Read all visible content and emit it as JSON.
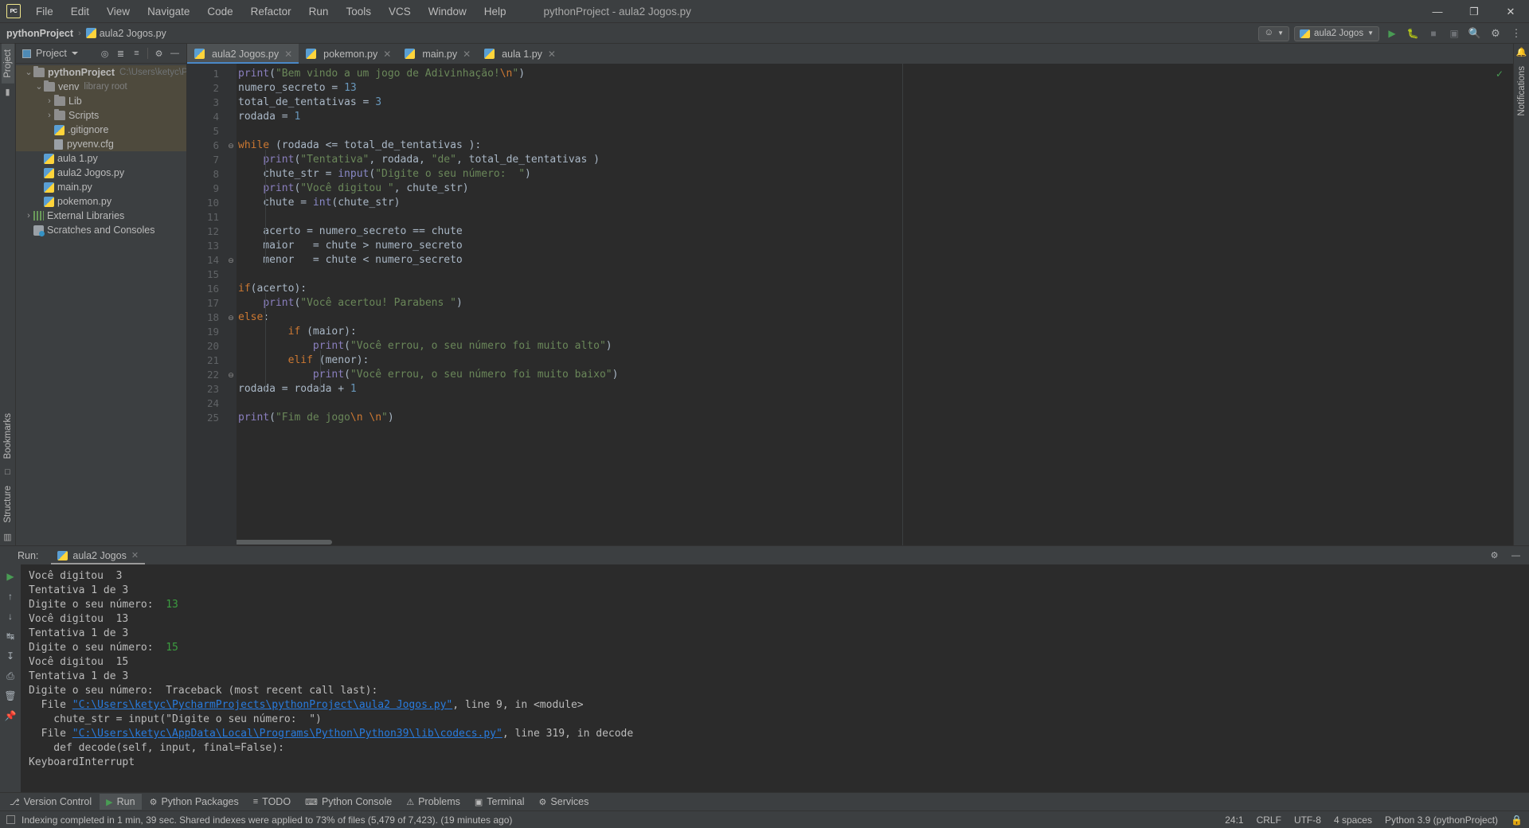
{
  "titlebar": {
    "logo": "PC",
    "menus": [
      "File",
      "Edit",
      "View",
      "Navigate",
      "Code",
      "Refactor",
      "Run",
      "Tools",
      "VCS",
      "Window",
      "Help"
    ],
    "project_title": "pythonProject - aula2 Jogos.py",
    "minimize": "—",
    "maximize": "❐",
    "close": "✕"
  },
  "navbar": {
    "crumb_project": "pythonProject",
    "crumb_sep": "›",
    "crumb_file": "aula2 Jogos.py",
    "run_config": "aula2 Jogos",
    "run_icon": "▶",
    "debug_icon": "🐞",
    "stop_icon": "■",
    "coverage_icon": "▣",
    "search_icon": "🔍",
    "settings_icon": "⚙",
    "account_icon": "👤",
    "more_icon": "⋮"
  },
  "left_strip": {
    "project_tab": "Project",
    "bookmarks_tab": "Bookmarks",
    "structure_tab": "Structure"
  },
  "right_strip": {
    "notifications_tab": "Notifications"
  },
  "project_panel": {
    "title": "Project",
    "tools": [
      "target-icon",
      "collapse-all-icon",
      "expand-all-icon",
      "gear-icon",
      "hide-icon"
    ],
    "tree": [
      {
        "depth": 0,
        "label": "pythonProject",
        "hint": "C:\\Users\\ketyc\\PycharmPr",
        "icon": "folder-icon",
        "arrow": "⌄",
        "bold": true,
        "highlight": true
      },
      {
        "depth": 1,
        "label": "venv",
        "hint": "library root",
        "icon": "folder-icon",
        "arrow": "⌄",
        "bold": false,
        "highlight": true
      },
      {
        "depth": 2,
        "label": "Lib",
        "hint": "",
        "icon": "folder-icon",
        "arrow": "›",
        "bold": false,
        "highlight": true
      },
      {
        "depth": 2,
        "label": "Scripts",
        "hint": "",
        "icon": "folder-icon",
        "arrow": "›",
        "bold": false,
        "highlight": true
      },
      {
        "depth": 2,
        "label": ".gitignore",
        "hint": "",
        "icon": "gitignore-icon",
        "arrow": "",
        "bold": false,
        "highlight": true
      },
      {
        "depth": 2,
        "label": "pyvenv.cfg",
        "hint": "",
        "icon": "config-file-icon",
        "arrow": "",
        "bold": false,
        "highlight": true
      },
      {
        "depth": 1,
        "label": "aula 1.py",
        "hint": "",
        "icon": "python-file-icon",
        "arrow": "",
        "bold": false,
        "highlight": false
      },
      {
        "depth": 1,
        "label": "aula2 Jogos.py",
        "hint": "",
        "icon": "python-file-icon",
        "arrow": "",
        "bold": false,
        "highlight": false
      },
      {
        "depth": 1,
        "label": "main.py",
        "hint": "",
        "icon": "python-file-icon",
        "arrow": "",
        "bold": false,
        "highlight": false
      },
      {
        "depth": 1,
        "label": "pokemon.py",
        "hint": "",
        "icon": "python-file-icon",
        "arrow": "",
        "bold": false,
        "highlight": false
      },
      {
        "depth": 0,
        "label": "External Libraries",
        "hint": "",
        "icon": "libraries-icon",
        "arrow": "›",
        "bold": false,
        "highlight": false
      },
      {
        "depth": 0,
        "label": "Scratches and Consoles",
        "hint": "",
        "icon": "scratches-icon",
        "arrow": "",
        "bold": false,
        "highlight": false
      }
    ]
  },
  "editor": {
    "tabs": [
      {
        "label": "aula2 Jogos.py",
        "active": true
      },
      {
        "label": "pokemon.py",
        "active": false
      },
      {
        "label": "main.py",
        "active": false
      },
      {
        "label": "aula 1.py",
        "active": false
      }
    ],
    "close_glyph": "✕",
    "line_numbers": [
      1,
      2,
      3,
      4,
      5,
      6,
      7,
      8,
      9,
      10,
      11,
      12,
      13,
      14,
      15,
      16,
      17,
      18,
      19,
      20,
      21,
      22,
      23,
      24,
      25
    ],
    "code_lines": [
      {
        "n": 1,
        "tokens": [
          {
            "t": "print",
            "c": "f"
          },
          {
            "t": "(",
            "c": "p"
          },
          {
            "t": "\"Bem vindo a um jogo de Adivinhação!",
            "c": "s"
          },
          {
            "t": "\\n",
            "c": "e"
          },
          {
            "t": "\"",
            "c": "s"
          },
          {
            "t": ")",
            "c": "p"
          }
        ]
      },
      {
        "n": 2,
        "tokens": [
          {
            "t": "numero_secreto = ",
            "c": "p"
          },
          {
            "t": "13",
            "c": "n"
          }
        ]
      },
      {
        "n": 3,
        "tokens": [
          {
            "t": "total_de_tentativas = ",
            "c": "p"
          },
          {
            "t": "3",
            "c": "n"
          }
        ]
      },
      {
        "n": 4,
        "tokens": [
          {
            "t": "rodada = ",
            "c": "p"
          },
          {
            "t": "1",
            "c": "n"
          }
        ]
      },
      {
        "n": 5,
        "tokens": []
      },
      {
        "n": 6,
        "tokens": [
          {
            "t": "while",
            "c": "k"
          },
          {
            "t": " (rodada <= total_de_tentativas ):",
            "c": "p"
          }
        ]
      },
      {
        "n": 7,
        "tokens": [
          {
            "t": "    ",
            "c": "p"
          },
          {
            "t": "print",
            "c": "f"
          },
          {
            "t": "(",
            "c": "p"
          },
          {
            "t": "\"Tentativa\"",
            "c": "s"
          },
          {
            "t": ", rodada, ",
            "c": "p"
          },
          {
            "t": "\"de\"",
            "c": "s"
          },
          {
            "t": ", total_de_tentativas )",
            "c": "p"
          }
        ]
      },
      {
        "n": 8,
        "tokens": [
          {
            "t": "    chute_str = ",
            "c": "p"
          },
          {
            "t": "input",
            "c": "b"
          },
          {
            "t": "(",
            "c": "p"
          },
          {
            "t": "\"Digite o seu número:  \"",
            "c": "s"
          },
          {
            "t": ")",
            "c": "p"
          }
        ]
      },
      {
        "n": 9,
        "tokens": [
          {
            "t": "    ",
            "c": "p"
          },
          {
            "t": "print",
            "c": "f"
          },
          {
            "t": "(",
            "c": "p"
          },
          {
            "t": "\"Você digitou \"",
            "c": "s"
          },
          {
            "t": ", chute_str)",
            "c": "p"
          }
        ]
      },
      {
        "n": 10,
        "tokens": [
          {
            "t": "    chute = ",
            "c": "p"
          },
          {
            "t": "int",
            "c": "b"
          },
          {
            "t": "(chute_str)",
            "c": "p"
          }
        ]
      },
      {
        "n": 11,
        "tokens": []
      },
      {
        "n": 12,
        "tokens": [
          {
            "t": "    acerto = numero_secreto == chute",
            "c": "p"
          }
        ]
      },
      {
        "n": 13,
        "tokens": [
          {
            "t": "    maior   = chute > numero_secreto",
            "c": "p"
          }
        ]
      },
      {
        "n": 14,
        "tokens": [
          {
            "t": "    menor   = chute < numero_secreto",
            "c": "p"
          }
        ]
      },
      {
        "n": 15,
        "tokens": []
      },
      {
        "n": 16,
        "tokens": [
          {
            "t": "if",
            "c": "k"
          },
          {
            "t": "(acerto):",
            "c": "p"
          }
        ]
      },
      {
        "n": 17,
        "tokens": [
          {
            "t": "    ",
            "c": "p"
          },
          {
            "t": "print",
            "c": "f"
          },
          {
            "t": "(",
            "c": "p"
          },
          {
            "t": "\"Você acertou! Parabens \"",
            "c": "s"
          },
          {
            "t": ")",
            "c": "p"
          }
        ]
      },
      {
        "n": 18,
        "tokens": [
          {
            "t": "else",
            "c": "k"
          },
          {
            "t": ":",
            "c": "p"
          }
        ]
      },
      {
        "n": 19,
        "tokens": [
          {
            "t": "        ",
            "c": "p"
          },
          {
            "t": "if",
            "c": "k"
          },
          {
            "t": " (maior):",
            "c": "p"
          }
        ]
      },
      {
        "n": 20,
        "tokens": [
          {
            "t": "            ",
            "c": "p"
          },
          {
            "t": "print",
            "c": "f"
          },
          {
            "t": "(",
            "c": "p"
          },
          {
            "t": "\"Você errou, o seu número foi muito alto\"",
            "c": "s"
          },
          {
            "t": ")",
            "c": "p"
          }
        ]
      },
      {
        "n": 21,
        "tokens": [
          {
            "t": "        ",
            "c": "p"
          },
          {
            "t": "elif",
            "c": "k"
          },
          {
            "t": " (menor):",
            "c": "p"
          }
        ]
      },
      {
        "n": 22,
        "tokens": [
          {
            "t": "            ",
            "c": "p"
          },
          {
            "t": "print",
            "c": "f"
          },
          {
            "t": "(",
            "c": "p"
          },
          {
            "t": "\"Você errou, o seu número foi muito baixo\"",
            "c": "s"
          },
          {
            "t": ")",
            "c": "p"
          }
        ]
      },
      {
        "n": 23,
        "tokens": [
          {
            "t": "rodada = rodada + ",
            "c": "p"
          },
          {
            "t": "1",
            "c": "n"
          }
        ]
      },
      {
        "n": 24,
        "tokens": []
      },
      {
        "n": 25,
        "tokens": [
          {
            "t": "print",
            "c": "f"
          },
          {
            "t": "(",
            "c": "p"
          },
          {
            "t": "\"Fim de jogo",
            "c": "s"
          },
          {
            "t": "\\n",
            "c": "e"
          },
          {
            "t": " ",
            "c": "s"
          },
          {
            "t": "\\n",
            "c": "e"
          },
          {
            "t": "\"",
            "c": "s"
          },
          {
            "t": ")",
            "c": "p"
          }
        ]
      }
    ],
    "fold_marks": {
      "6": "⊖",
      "14": "⊖",
      "18": "⊖",
      "22": "⊖"
    },
    "inspection_status": "✓"
  },
  "run_panel": {
    "label": "Run:",
    "tab_name": "aula2 Jogos",
    "close_glyph": "✕",
    "settings_icon": "⚙",
    "hide_icon": "—",
    "toolbar_icons": [
      "rerun-icon",
      "up-icon",
      "down-icon",
      "soft-wrap-icon",
      "scroll-end-icon",
      "print-icon",
      "trash-icon",
      "pin-icon"
    ],
    "console_lines": [
      {
        "segments": [
          {
            "t": "Você digitou  3",
            "c": "c-out"
          }
        ]
      },
      {
        "segments": [
          {
            "t": "Tentativa 1 de 3",
            "c": "c-out"
          }
        ]
      },
      {
        "segments": [
          {
            "t": "Digite o seu número:  ",
            "c": "c-out"
          },
          {
            "t": "13",
            "c": "c-in"
          }
        ]
      },
      {
        "segments": [
          {
            "t": "Você digitou  13",
            "c": "c-out"
          }
        ]
      },
      {
        "segments": [
          {
            "t": "Tentativa 1 de 3",
            "c": "c-out"
          }
        ]
      },
      {
        "segments": [
          {
            "t": "Digite o seu número:  ",
            "c": "c-out"
          },
          {
            "t": "15",
            "c": "c-in"
          }
        ]
      },
      {
        "segments": [
          {
            "t": "Você digitou  15",
            "c": "c-out"
          }
        ]
      },
      {
        "segments": [
          {
            "t": "Tentativa 1 de 3",
            "c": "c-out"
          }
        ]
      },
      {
        "segments": [
          {
            "t": "Digite o seu número:  ",
            "c": "c-out"
          },
          {
            "t": "Traceback (most recent call last):",
            "c": "c-err"
          }
        ]
      },
      {
        "segments": [
          {
            "t": "  File ",
            "c": "c-err"
          },
          {
            "t": "\"C:\\Users\\ketyc\\PycharmProjects\\pythonProject\\aula2 Jogos.py\"",
            "c": "c-link"
          },
          {
            "t": ", line 9, in <module>",
            "c": "c-err"
          }
        ]
      },
      {
        "segments": [
          {
            "t": "    chute_str = input(\"Digite o seu número:  \")",
            "c": "c-err"
          }
        ]
      },
      {
        "segments": [
          {
            "t": "  File ",
            "c": "c-err"
          },
          {
            "t": "\"C:\\Users\\ketyc\\AppData\\Local\\Programs\\Python\\Python39\\lib\\codecs.py\"",
            "c": "c-link"
          },
          {
            "t": ", line 319, in decode",
            "c": "c-err"
          }
        ]
      },
      {
        "segments": [
          {
            "t": "    def decode(self, input, final=False):",
            "c": "c-err"
          }
        ]
      },
      {
        "segments": [
          {
            "t": "KeyboardInterrupt",
            "c": "c-exc"
          }
        ]
      }
    ]
  },
  "tool_window_bar": [
    {
      "label": "Version Control",
      "icon": "branch-icon",
      "selected": false
    },
    {
      "label": "Run",
      "icon": "run-icon",
      "selected": true
    },
    {
      "label": "Python Packages",
      "icon": "package-icon",
      "selected": false
    },
    {
      "label": "TODO",
      "icon": "todo-icon",
      "selected": false
    },
    {
      "label": "Python Console",
      "icon": "console-icon",
      "selected": false
    },
    {
      "label": "Problems",
      "icon": "problems-icon",
      "selected": false
    },
    {
      "label": "Terminal",
      "icon": "terminal-icon",
      "selected": false
    },
    {
      "label": "Services",
      "icon": "services-icon",
      "selected": false
    }
  ],
  "statusbar": {
    "message": "Indexing completed in 1 min, 39 sec. Shared indexes were applied to 73% of files (5,479 of 7,423). (19 minutes ago)",
    "caret": "24:1",
    "line_separator": "CRLF",
    "encoding": "UTF-8",
    "indent": "4 spaces",
    "interpreter": "Python 3.9 (pythonProject)",
    "lock_icon": "🔒"
  }
}
